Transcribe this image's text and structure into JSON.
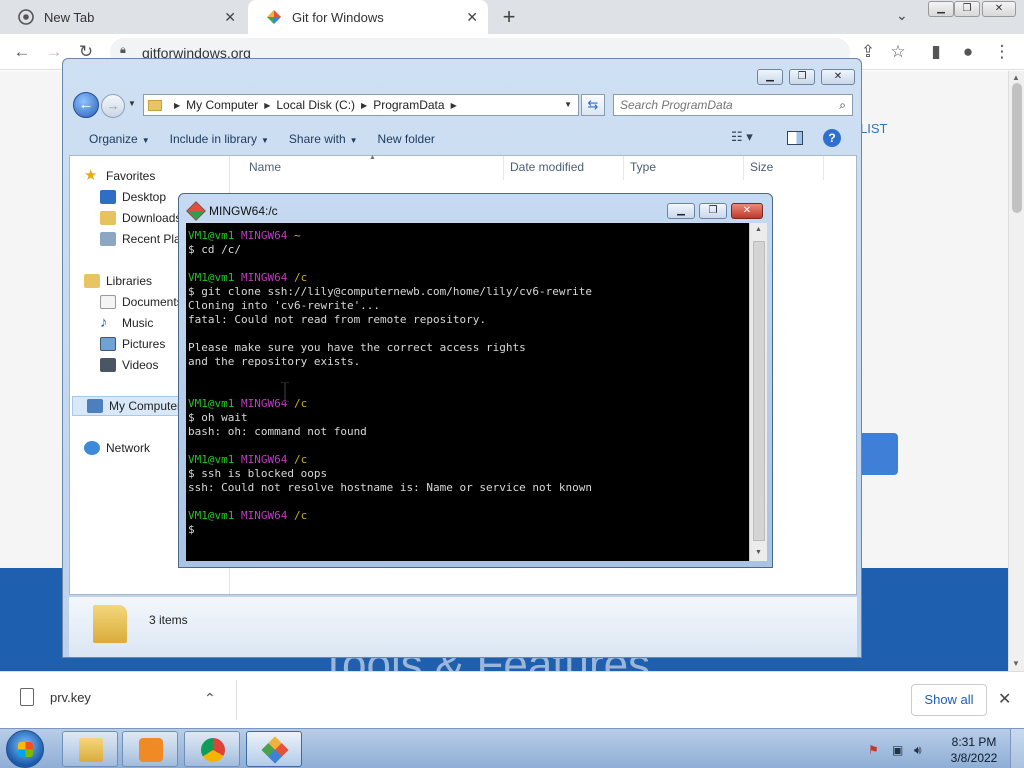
{
  "chrome": {
    "tabs": [
      {
        "title": "New Tab",
        "icon": "chrome-icon"
      },
      {
        "title": "Git for Windows",
        "icon": "git-diamond-icon"
      }
    ],
    "url": "gitforwindows.org"
  },
  "webpage": {
    "list_link": "LIST",
    "heading": "Tools & Features"
  },
  "downloads": {
    "filename": "prv.key",
    "show_all": "Show all"
  },
  "explorer": {
    "breadcrumb": [
      "My Computer",
      "Local Disk (C:)",
      "ProgramData"
    ],
    "search_placeholder": "Search ProgramData",
    "commands": [
      {
        "label": "Organize",
        "dropdown": true
      },
      {
        "label": "Include in library",
        "dropdown": true
      },
      {
        "label": "Share with",
        "dropdown": true
      },
      {
        "label": "New folder",
        "dropdown": false
      }
    ],
    "nav": {
      "favorites": "Favorites",
      "desktop": "Desktop",
      "downloads": "Downloads",
      "recent": "Recent Places",
      "libraries": "Libraries",
      "documents": "Documents",
      "music": "Music",
      "pictures": "Pictures",
      "videos": "Videos",
      "computer": "My Computer",
      "network": "Network"
    },
    "columns": [
      "Name",
      "Date modified",
      "Type",
      "Size"
    ],
    "status": "3 items"
  },
  "terminal": {
    "title": "MINGW64:/c",
    "lines": [
      {
        "kind": "prompt",
        "user": "VM1@vm1",
        "host": "MINGW64",
        "path": "~"
      },
      {
        "kind": "text",
        "text": "$ cd /c/"
      },
      {
        "kind": "blank"
      },
      {
        "kind": "prompt",
        "user": "VM1@vm1",
        "host": "MINGW64",
        "path": "/c"
      },
      {
        "kind": "text",
        "text": "$ git clone ssh://lily@computernewb.com/home/lily/cv6-rewrite"
      },
      {
        "kind": "text",
        "text": "Cloning into 'cv6-rewrite'..."
      },
      {
        "kind": "text",
        "text": "fatal: Could not read from remote repository."
      },
      {
        "kind": "blank"
      },
      {
        "kind": "text",
        "text": "Please make sure you have the correct access rights"
      },
      {
        "kind": "text",
        "text": "and the repository exists."
      },
      {
        "kind": "blank"
      },
      {
        "kind": "blank"
      },
      {
        "kind": "prompt",
        "user": "VM1@vm1",
        "host": "MINGW64",
        "path": "/c"
      },
      {
        "kind": "text",
        "text": "$ oh wait"
      },
      {
        "kind": "text",
        "text": "bash: oh: command not found"
      },
      {
        "kind": "blank"
      },
      {
        "kind": "prompt",
        "user": "VM1@vm1",
        "host": "MINGW64",
        "path": "/c"
      },
      {
        "kind": "text",
        "text": "$ ssh is blocked oops"
      },
      {
        "kind": "text",
        "text": "ssh: Could not resolve hostname is: Name or service not known"
      },
      {
        "kind": "blank"
      },
      {
        "kind": "prompt",
        "user": "VM1@vm1",
        "host": "MINGW64",
        "path": "/c"
      },
      {
        "kind": "text",
        "text": "$"
      }
    ]
  },
  "taskbar": {
    "time": "8:31 PM",
    "date": "3/8/2022"
  }
}
